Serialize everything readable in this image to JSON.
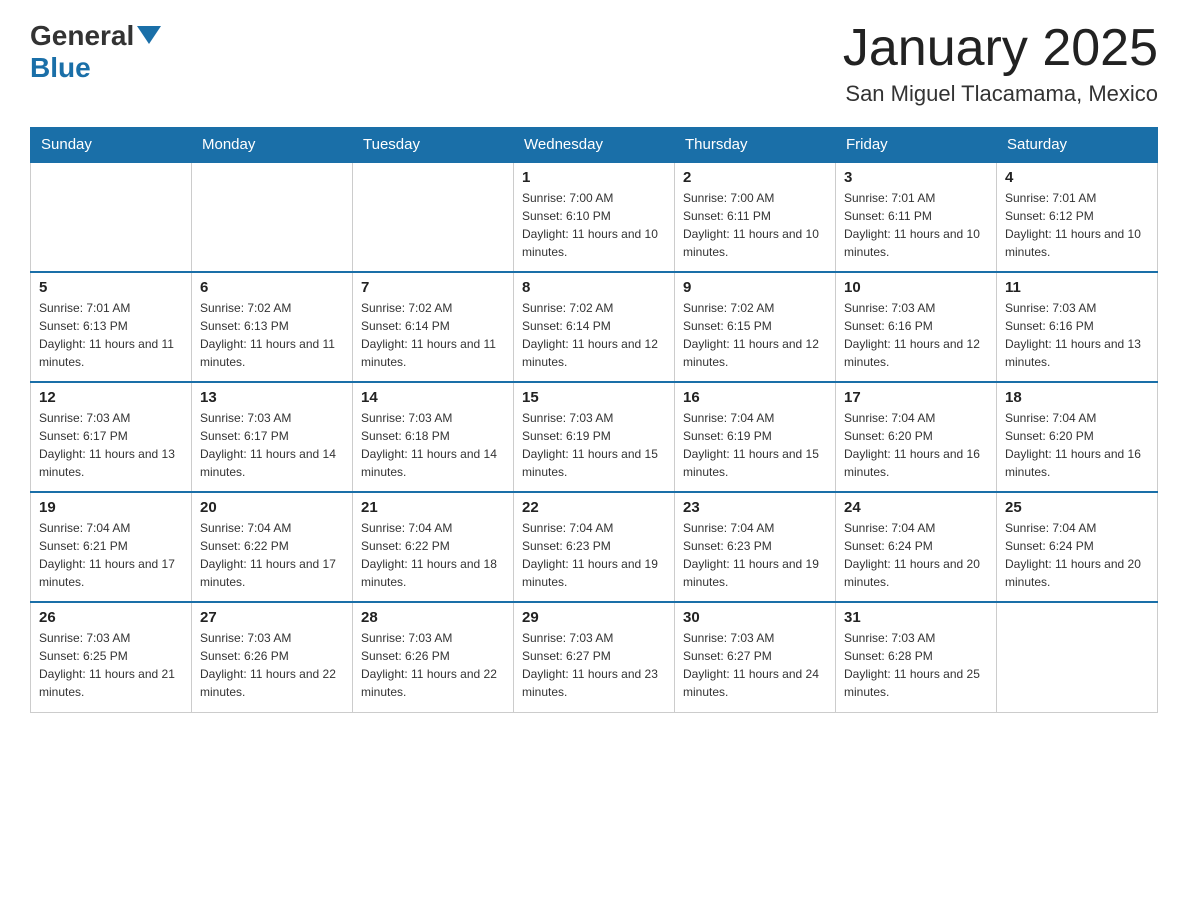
{
  "header": {
    "logo_general": "General",
    "logo_blue": "Blue",
    "month_title": "January 2025",
    "location": "San Miguel Tlacamama, Mexico"
  },
  "days_of_week": [
    "Sunday",
    "Monday",
    "Tuesday",
    "Wednesday",
    "Thursday",
    "Friday",
    "Saturday"
  ],
  "weeks": [
    [
      {
        "day": "",
        "info": ""
      },
      {
        "day": "",
        "info": ""
      },
      {
        "day": "",
        "info": ""
      },
      {
        "day": "1",
        "sunrise": "Sunrise: 7:00 AM",
        "sunset": "Sunset: 6:10 PM",
        "daylight": "Daylight: 11 hours and 10 minutes."
      },
      {
        "day": "2",
        "sunrise": "Sunrise: 7:00 AM",
        "sunset": "Sunset: 6:11 PM",
        "daylight": "Daylight: 11 hours and 10 minutes."
      },
      {
        "day": "3",
        "sunrise": "Sunrise: 7:01 AM",
        "sunset": "Sunset: 6:11 PM",
        "daylight": "Daylight: 11 hours and 10 minutes."
      },
      {
        "day": "4",
        "sunrise": "Sunrise: 7:01 AM",
        "sunset": "Sunset: 6:12 PM",
        "daylight": "Daylight: 11 hours and 10 minutes."
      }
    ],
    [
      {
        "day": "5",
        "sunrise": "Sunrise: 7:01 AM",
        "sunset": "Sunset: 6:13 PM",
        "daylight": "Daylight: 11 hours and 11 minutes."
      },
      {
        "day": "6",
        "sunrise": "Sunrise: 7:02 AM",
        "sunset": "Sunset: 6:13 PM",
        "daylight": "Daylight: 11 hours and 11 minutes."
      },
      {
        "day": "7",
        "sunrise": "Sunrise: 7:02 AM",
        "sunset": "Sunset: 6:14 PM",
        "daylight": "Daylight: 11 hours and 11 minutes."
      },
      {
        "day": "8",
        "sunrise": "Sunrise: 7:02 AM",
        "sunset": "Sunset: 6:14 PM",
        "daylight": "Daylight: 11 hours and 12 minutes."
      },
      {
        "day": "9",
        "sunrise": "Sunrise: 7:02 AM",
        "sunset": "Sunset: 6:15 PM",
        "daylight": "Daylight: 11 hours and 12 minutes."
      },
      {
        "day": "10",
        "sunrise": "Sunrise: 7:03 AM",
        "sunset": "Sunset: 6:16 PM",
        "daylight": "Daylight: 11 hours and 12 minutes."
      },
      {
        "day": "11",
        "sunrise": "Sunrise: 7:03 AM",
        "sunset": "Sunset: 6:16 PM",
        "daylight": "Daylight: 11 hours and 13 minutes."
      }
    ],
    [
      {
        "day": "12",
        "sunrise": "Sunrise: 7:03 AM",
        "sunset": "Sunset: 6:17 PM",
        "daylight": "Daylight: 11 hours and 13 minutes."
      },
      {
        "day": "13",
        "sunrise": "Sunrise: 7:03 AM",
        "sunset": "Sunset: 6:17 PM",
        "daylight": "Daylight: 11 hours and 14 minutes."
      },
      {
        "day": "14",
        "sunrise": "Sunrise: 7:03 AM",
        "sunset": "Sunset: 6:18 PM",
        "daylight": "Daylight: 11 hours and 14 minutes."
      },
      {
        "day": "15",
        "sunrise": "Sunrise: 7:03 AM",
        "sunset": "Sunset: 6:19 PM",
        "daylight": "Daylight: 11 hours and 15 minutes."
      },
      {
        "day": "16",
        "sunrise": "Sunrise: 7:04 AM",
        "sunset": "Sunset: 6:19 PM",
        "daylight": "Daylight: 11 hours and 15 minutes."
      },
      {
        "day": "17",
        "sunrise": "Sunrise: 7:04 AM",
        "sunset": "Sunset: 6:20 PM",
        "daylight": "Daylight: 11 hours and 16 minutes."
      },
      {
        "day": "18",
        "sunrise": "Sunrise: 7:04 AM",
        "sunset": "Sunset: 6:20 PM",
        "daylight": "Daylight: 11 hours and 16 minutes."
      }
    ],
    [
      {
        "day": "19",
        "sunrise": "Sunrise: 7:04 AM",
        "sunset": "Sunset: 6:21 PM",
        "daylight": "Daylight: 11 hours and 17 minutes."
      },
      {
        "day": "20",
        "sunrise": "Sunrise: 7:04 AM",
        "sunset": "Sunset: 6:22 PM",
        "daylight": "Daylight: 11 hours and 17 minutes."
      },
      {
        "day": "21",
        "sunrise": "Sunrise: 7:04 AM",
        "sunset": "Sunset: 6:22 PM",
        "daylight": "Daylight: 11 hours and 18 minutes."
      },
      {
        "day": "22",
        "sunrise": "Sunrise: 7:04 AM",
        "sunset": "Sunset: 6:23 PM",
        "daylight": "Daylight: 11 hours and 19 minutes."
      },
      {
        "day": "23",
        "sunrise": "Sunrise: 7:04 AM",
        "sunset": "Sunset: 6:23 PM",
        "daylight": "Daylight: 11 hours and 19 minutes."
      },
      {
        "day": "24",
        "sunrise": "Sunrise: 7:04 AM",
        "sunset": "Sunset: 6:24 PM",
        "daylight": "Daylight: 11 hours and 20 minutes."
      },
      {
        "day": "25",
        "sunrise": "Sunrise: 7:04 AM",
        "sunset": "Sunset: 6:24 PM",
        "daylight": "Daylight: 11 hours and 20 minutes."
      }
    ],
    [
      {
        "day": "26",
        "sunrise": "Sunrise: 7:03 AM",
        "sunset": "Sunset: 6:25 PM",
        "daylight": "Daylight: 11 hours and 21 minutes."
      },
      {
        "day": "27",
        "sunrise": "Sunrise: 7:03 AM",
        "sunset": "Sunset: 6:26 PM",
        "daylight": "Daylight: 11 hours and 22 minutes."
      },
      {
        "day": "28",
        "sunrise": "Sunrise: 7:03 AM",
        "sunset": "Sunset: 6:26 PM",
        "daylight": "Daylight: 11 hours and 22 minutes."
      },
      {
        "day": "29",
        "sunrise": "Sunrise: 7:03 AM",
        "sunset": "Sunset: 6:27 PM",
        "daylight": "Daylight: 11 hours and 23 minutes."
      },
      {
        "day": "30",
        "sunrise": "Sunrise: 7:03 AM",
        "sunset": "Sunset: 6:27 PM",
        "daylight": "Daylight: 11 hours and 24 minutes."
      },
      {
        "day": "31",
        "sunrise": "Sunrise: 7:03 AM",
        "sunset": "Sunset: 6:28 PM",
        "daylight": "Daylight: 11 hours and 25 minutes."
      },
      {
        "day": "",
        "info": ""
      }
    ]
  ]
}
